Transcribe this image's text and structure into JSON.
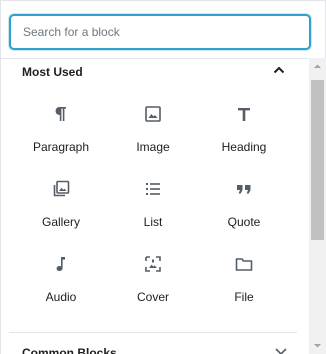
{
  "search": {
    "placeholder": "Search for a block",
    "value": ""
  },
  "sections": [
    {
      "title": "Most Used",
      "expanded": true,
      "blocks": [
        {
          "label": "Paragraph",
          "icon": "paragraph-icon"
        },
        {
          "label": "Image",
          "icon": "image-icon"
        },
        {
          "label": "Heading",
          "icon": "heading-icon"
        },
        {
          "label": "Gallery",
          "icon": "gallery-icon"
        },
        {
          "label": "List",
          "icon": "list-icon"
        },
        {
          "label": "Quote",
          "icon": "quote-icon"
        },
        {
          "label": "Audio",
          "icon": "audio-icon"
        },
        {
          "label": "Cover",
          "icon": "cover-icon"
        },
        {
          "label": "File",
          "icon": "file-icon"
        }
      ]
    },
    {
      "title": "Common Blocks",
      "expanded": false
    }
  ],
  "colors": {
    "accent": "#2ea2cc",
    "text": "#1e1e1e",
    "icon": "#555d66",
    "border": "#e2e4e7",
    "scrollbar_track": "#f1f1f1",
    "scrollbar_thumb": "#c1c1c1"
  }
}
